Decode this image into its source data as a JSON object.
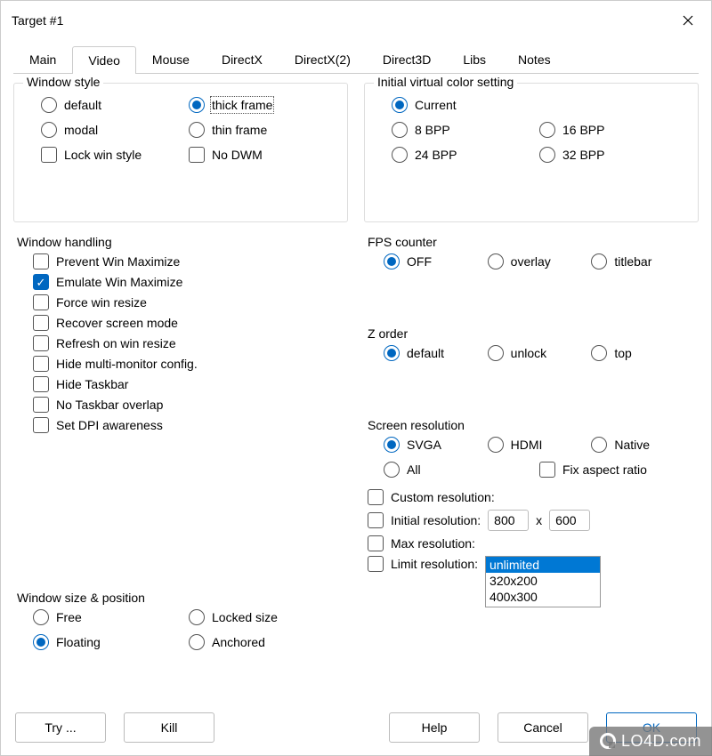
{
  "title": "Target #1",
  "tabs": [
    "Main",
    "Video",
    "Mouse",
    "DirectX",
    "DirectX(2)",
    "Direct3D",
    "Libs",
    "Notes"
  ],
  "activeTab": "Video",
  "windowStyle": {
    "legend": "Window style",
    "default": "default",
    "thick": "thick frame",
    "modal": "modal",
    "thin": "thin frame",
    "lock": "Lock win style",
    "nodwm": "No DWM"
  },
  "colorSetting": {
    "legend": "Initial virtual color setting",
    "current": "Current",
    "bpp8": "8 BPP",
    "bpp16": "16 BPP",
    "bpp24": "24 BPP",
    "bpp32": "32 BPP"
  },
  "handling": {
    "legend": "Window handling",
    "items": [
      "Prevent Win Maximize",
      "Emulate Win Maximize",
      "Force win resize",
      "Recover screen mode",
      "Refresh on win resize",
      "Hide multi-monitor config.",
      "Hide Taskbar",
      "No Taskbar overlap",
      "Set DPI awareness"
    ],
    "checkedIndex": 1
  },
  "fps": {
    "legend": "FPS counter",
    "off": "OFF",
    "overlay": "overlay",
    "titlebar": "titlebar"
  },
  "zorder": {
    "legend": "Z order",
    "default": "default",
    "unlock": "unlock",
    "top": "top"
  },
  "screen": {
    "legend": "Screen resolution",
    "svga": "SVGA",
    "hdmi": "HDMI",
    "native": "Native",
    "all": "All",
    "fixaspect": "Fix aspect ratio",
    "custom": "Custom resolution:",
    "initial": "Initial resolution:",
    "initW": "800",
    "initH": "600",
    "x": "x",
    "max": "Max resolution:",
    "limit": "Limit  resolution:",
    "listbox": [
      "unlimited",
      "320x200",
      "400x300"
    ]
  },
  "sizepos": {
    "legend": "Window size & position",
    "free": "Free",
    "floating": "Floating",
    "locked": "Locked size",
    "anchored": "Anchored"
  },
  "buttons": {
    "try": "Try ...",
    "kill": "Kill",
    "help": "Help",
    "cancel": "Cancel",
    "ok": "OK"
  },
  "watermark": "LO4D.com"
}
